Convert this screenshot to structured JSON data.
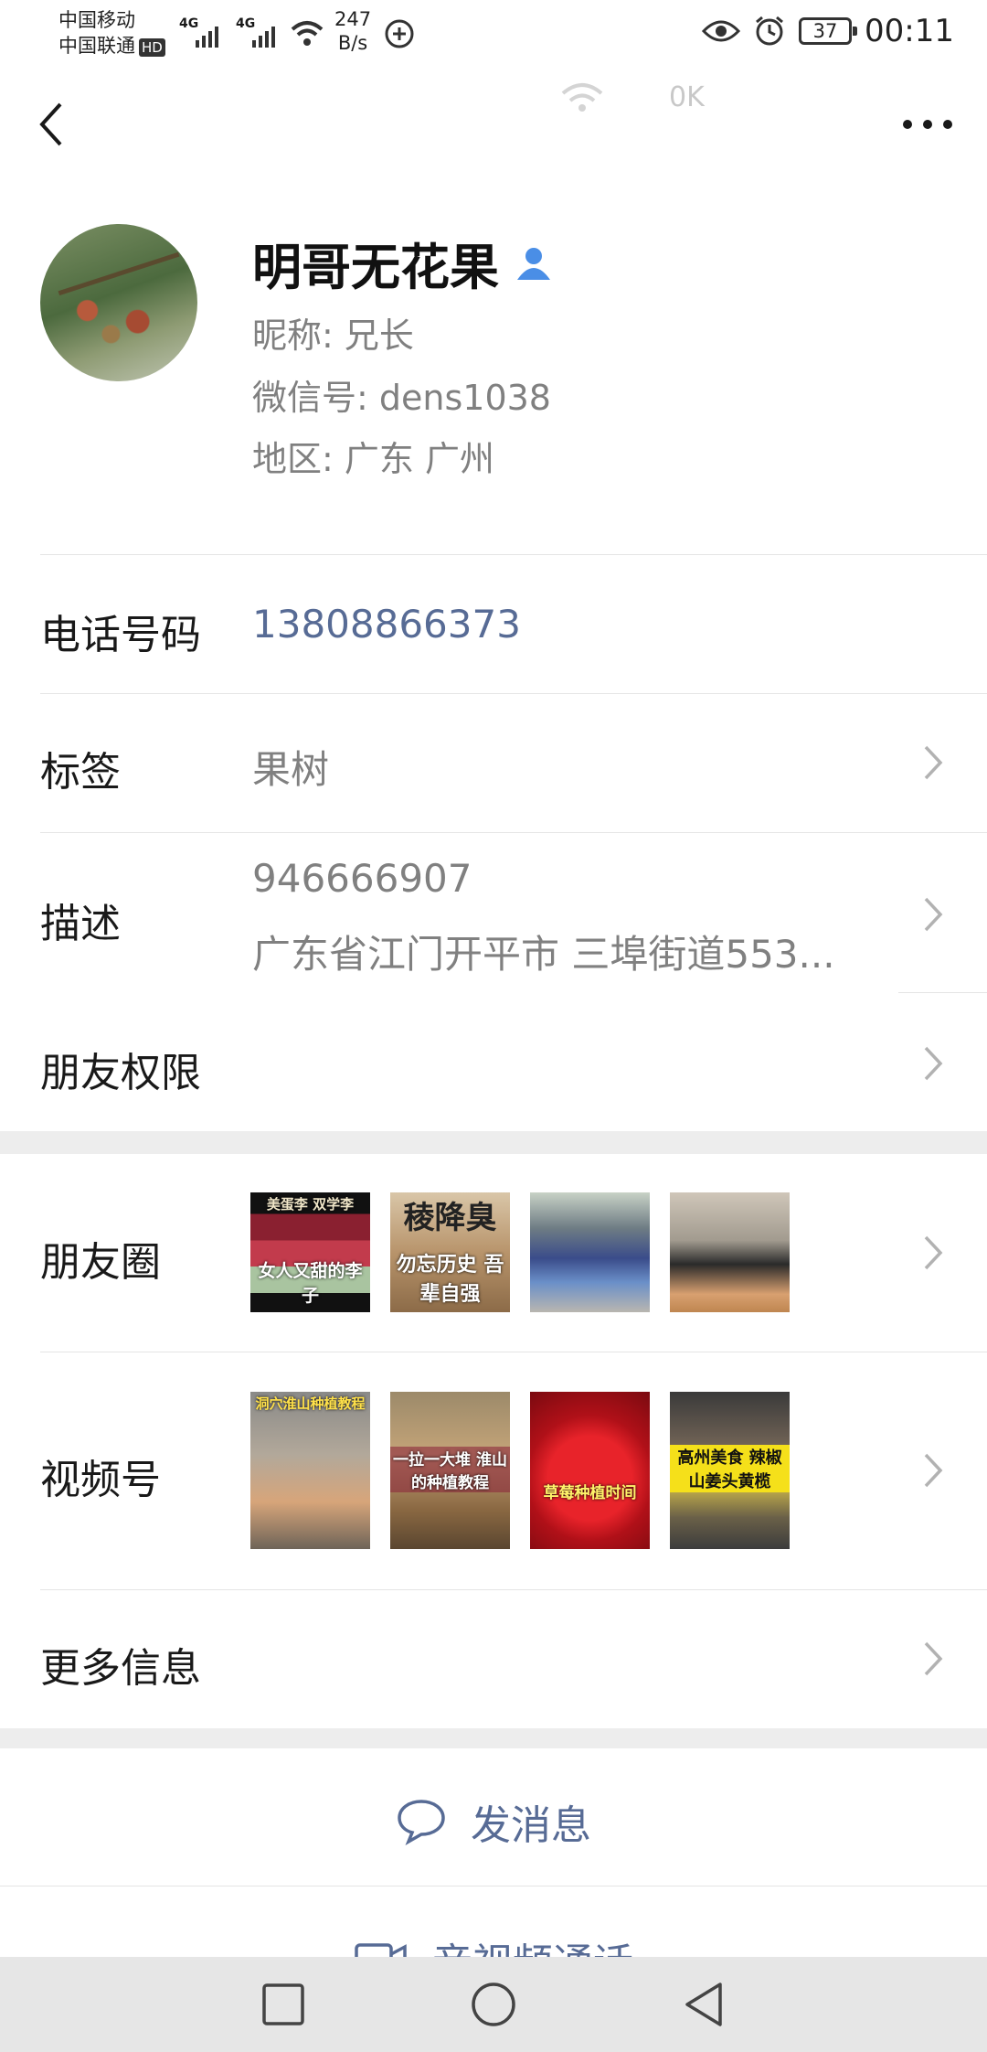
{
  "status_bar": {
    "carrier_1": "中国移动",
    "carrier_2": "中国联通",
    "hd_badge": "HD",
    "network_1": "4G",
    "network_2": "4G",
    "net_speed_value": "247",
    "net_speed_unit": "B/s",
    "battery": "37",
    "time": "00:11"
  },
  "nav": {
    "ghost_speed": "0K"
  },
  "profile": {
    "name": "明哥无花果",
    "nickname": "昵称:  兄长",
    "wechat_id": "微信号:  dens1038",
    "region": "地区:  广东  广州"
  },
  "rows": {
    "phone_label": "电话号码",
    "phone_value": "13808866373",
    "tags_label": "标签",
    "tags_value": "果树",
    "desc_label": "描述",
    "desc_line1": "946666907",
    "desc_line2": "广东省江门开平市 三埠街道553...",
    "permissions_label": "朋友权限",
    "moments_label": "朋友圈",
    "channels_label": "视频号",
    "more_info_label": "更多信息"
  },
  "moments_thumbs": [
    {
      "caption_top": "美蛋李  双学李",
      "caption_bottom": "女人又甜的李子"
    },
    {
      "caption_top": "稜降臭",
      "caption_bottom": "勿忘历史 吾辈自强"
    },
    {
      "caption_top": "",
      "caption_bottom": ""
    },
    {
      "caption_top": "",
      "caption_bottom": ""
    }
  ],
  "channels_thumbs": [
    {
      "caption": "洞穴淮山种植教程"
    },
    {
      "caption": "一拉一大堆 淮山的种植教程"
    },
    {
      "caption": "草莓种植时间"
    },
    {
      "caption": "高州美食 辣椒山姜头黄榄"
    }
  ],
  "actions": {
    "message": "发消息",
    "call": "音视频通话"
  },
  "colors": {
    "link_blue": "#576b95",
    "background": "#ededed",
    "person_icon_blue": "#4a8ee6"
  }
}
